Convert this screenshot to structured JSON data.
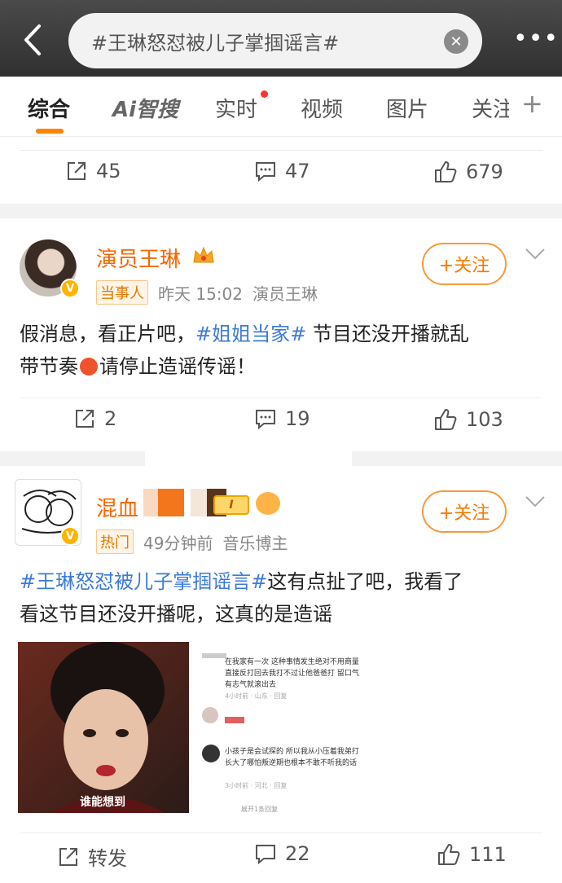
{
  "header": {
    "search_query": "#王琳怒怼被儿子掌掴谣言#"
  },
  "tabs": [
    {
      "label": "综合"
    },
    {
      "label": "Ai智搜"
    },
    {
      "label": "实时"
    },
    {
      "label": "视频"
    },
    {
      "label": "图片"
    },
    {
      "label": "关注"
    }
  ],
  "posts": [
    {
      "repost_count": "45",
      "comment_count": "47",
      "like_count": "679"
    },
    {
      "author": "演员王琳",
      "tag": "当事人",
      "time": "昨天 15:02",
      "source": "演员王琳",
      "follow_label": "+关注",
      "text_before": "假消息，看正片吧，",
      "topic": "#姐姐当家#",
      "text_after1": " 节目还没开播就乱",
      "text_line2a": "带节奏",
      "text_line2b": "请停止造谣传谣！",
      "repost_count": "2",
      "comment_count": "19",
      "like_count": "103"
    },
    {
      "author": "混血",
      "tag": "热门",
      "time": "49分钟前",
      "source": "音乐博主",
      "follow_label": "+关注",
      "topic": "#王琳怒怼被儿子掌掴谣言#",
      "text_after1": "这有点扯了吧，我看了",
      "text_line2": "看这节目还没开播呢，这真的是造谣",
      "image1_caption": "谁能想到",
      "image2_lines": [
        "在我家有一次 这种事情发生绝对不用商量",
        "直接反打回去我打不过让他爸爸打 留口气",
        "有志气就滚出去",
        "4小时前 · 山东 · 回复",
        "小孩子是会试探的 所以我从小压着我弟打",
        "长大了哪怕叛逆期也根本不敢不听我的话",
        "3小时前 · 河北 · 回复",
        "展开1条回复"
      ],
      "repost_label": "转发",
      "comment_count": "22",
      "like_count": "111"
    }
  ]
}
